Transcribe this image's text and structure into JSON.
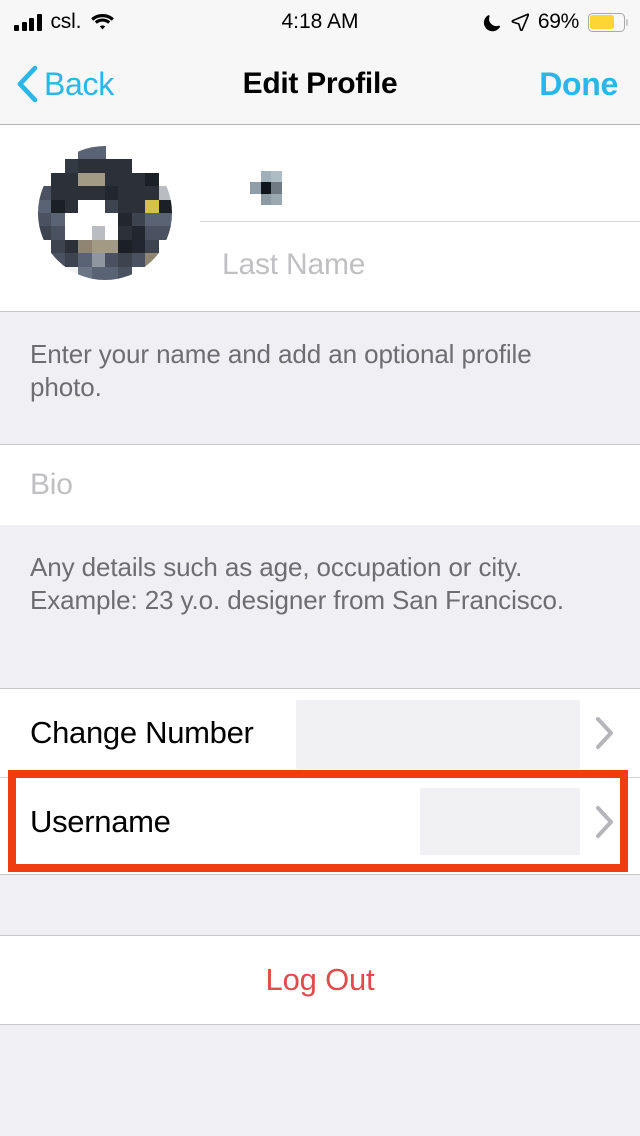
{
  "status_bar": {
    "carrier": "csl.",
    "signal_icon": "signal-bars-icon",
    "wifi_icon": "wifi-icon",
    "time": "4:18 AM",
    "dnd_icon": "moon-icon",
    "location_icon": "location-arrow-icon",
    "battery_percent": "69%",
    "battery_icon": "battery-low-power-icon",
    "battery_fill_pct": 69,
    "battery_color": "#fdd633"
  },
  "nav_bar": {
    "back_label": "Back",
    "back_icon": "chevron-left-icon",
    "title": "Edit Profile",
    "done_label": "Done",
    "accent_color": "#29b6e8"
  },
  "profile": {
    "avatar_name": "profile-photo-pixelated",
    "first_name_value": "",
    "first_name_redacted": true,
    "last_name_placeholder": "Last Name",
    "name_hint": "Enter your name and add an optional profile photo."
  },
  "bio": {
    "placeholder": "Bio",
    "hint": "Any details such as age, occupation or city. Example: 23 y.o. designer from San Francisco."
  },
  "settings_rows": [
    {
      "label": "Change Number",
      "value": "",
      "value_redacted": true,
      "accessory_icon": "chevron-right-icon",
      "highlighted": false
    },
    {
      "label": "Username",
      "value": "",
      "value_redacted": true,
      "accessory_icon": "chevron-right-icon",
      "highlighted": true
    }
  ],
  "highlight": {
    "target": "Username",
    "color": "#f03c11"
  },
  "logout": {
    "label": "Log Out",
    "color": "#e14b4b"
  }
}
